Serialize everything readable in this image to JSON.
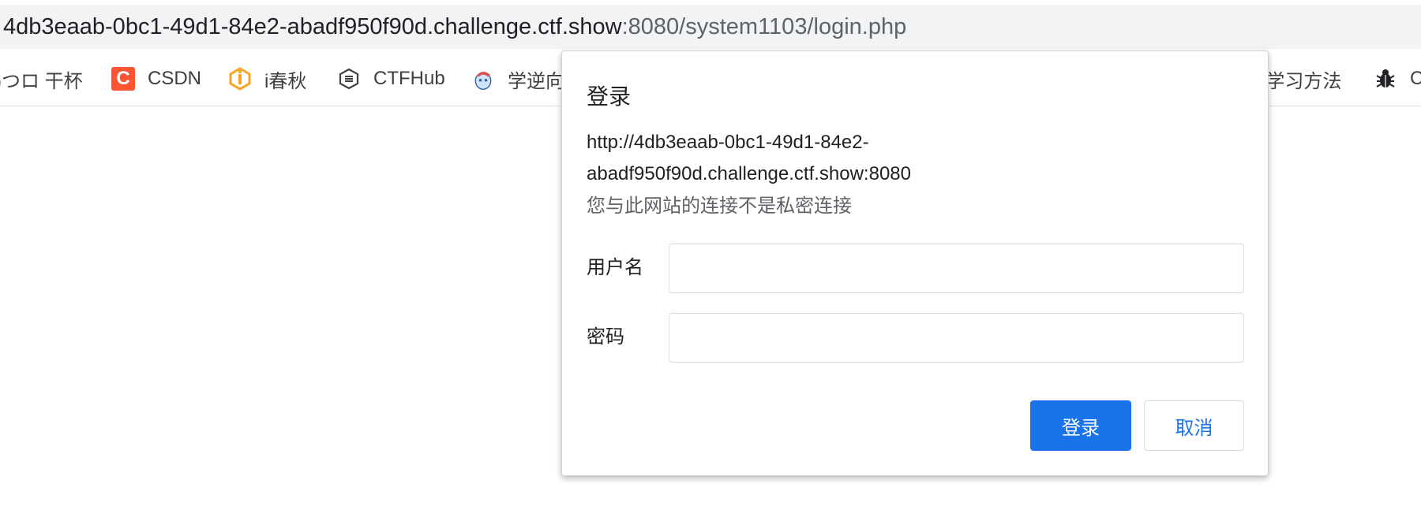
{
  "browser": {
    "url_host": "4db3eaab-0bc1-49d1-84e2-abadf950f90d.challenge.ctf.show",
    "url_path": ":8080/system1103/login.php"
  },
  "bookmarks": [
    {
      "label": ")つロ 干杯",
      "icon": "none"
    },
    {
      "label": "CSDN",
      "icon": "csdn-icon"
    },
    {
      "label": "i春秋",
      "icon": "ichunqiu-icon"
    },
    {
      "label": "CTFHub",
      "icon": "ctfhub-icon"
    },
    {
      "label": "学逆向",
      "icon": "mascot-icon"
    },
    {
      "label": "l学习方法",
      "icon": "none"
    },
    {
      "label": "C",
      "icon": "bug-icon"
    }
  ],
  "dialog": {
    "title": "登录",
    "url_line1": "http://4db3eaab-0bc1-49d1-84e2-",
    "url_line2": "abadf950f90d.challenge.ctf.show:8080",
    "warning": "您与此网站的连接不是私密连接",
    "username_label": "用户名",
    "username_value": "",
    "password_label": "密码",
    "password_value": "",
    "login_button": "登录",
    "cancel_button": "取消"
  },
  "colors": {
    "accent": "#1a73e8",
    "csdn": "#fc5531",
    "ichunqiu": "#f5a623"
  }
}
